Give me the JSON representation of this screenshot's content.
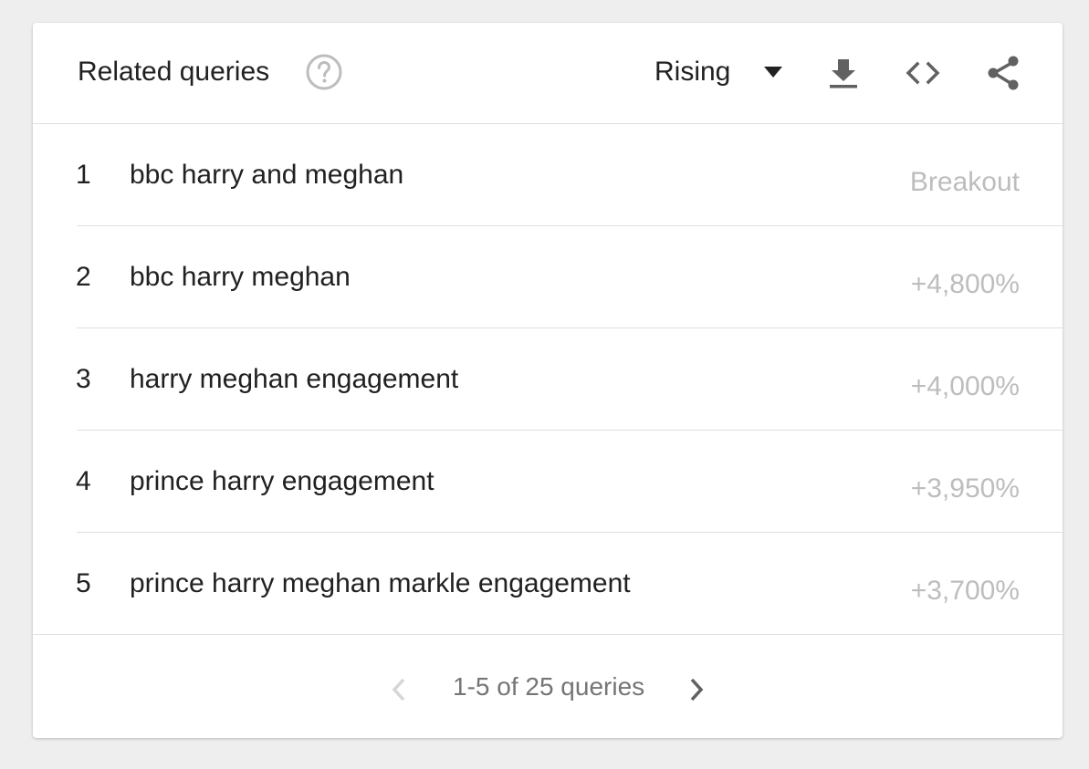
{
  "card": {
    "title": "Related queries",
    "dropdown": {
      "selected": "Rising"
    },
    "icons": {
      "help": "help-circle-icon",
      "dropdown": "caret-down-icon",
      "download": "download-icon",
      "embed": "code-embed-icon",
      "share": "share-icon",
      "prev": "chevron-left-icon",
      "next": "chevron-right-icon"
    }
  },
  "rows": [
    {
      "rank": "1",
      "query": "bbc harry and meghan",
      "value": "Breakout"
    },
    {
      "rank": "2",
      "query": "bbc harry meghan",
      "value": "+4,800%"
    },
    {
      "rank": "3",
      "query": "harry meghan engagement",
      "value": "+4,000%"
    },
    {
      "rank": "4",
      "query": "prince harry engagement",
      "value": "+3,950%"
    },
    {
      "rank": "5",
      "query": "prince harry meghan markle engagement",
      "value": "+3,700%"
    }
  ],
  "pager": {
    "label": "1-5 of 25 queries"
  },
  "colors": {
    "primary_text": "#212121",
    "muted_value": "#bdbdbd",
    "icon": "#616161",
    "disabled_icon": "#d6d6d6",
    "divider": "#e0e0e0",
    "background": "#eeeeee"
  }
}
